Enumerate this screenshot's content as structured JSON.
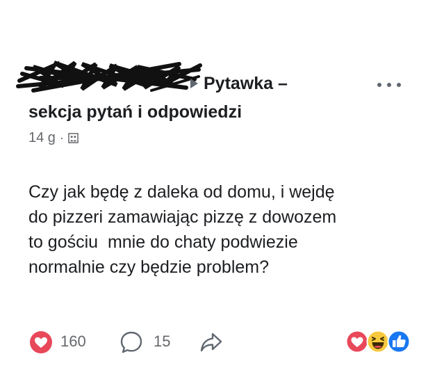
{
  "post": {
    "group_name_line1": "Pytawka –",
    "group_name_line2": "sekcja pytań i odpowiedzi",
    "timestamp": "14 g",
    "separator": "·",
    "body_lines": [
      "Czy jak będę z daleka od domu, i wejdę",
      "do pizzeri zamawiając pizzę z dowozem",
      "to gościu  mnie do chaty podwiezie",
      "normalnie czy będzie problem?"
    ]
  },
  "engagement": {
    "love_count": "160",
    "comment_count": "15"
  },
  "colors": {
    "love_red": "#e8485a",
    "like_blue": "#1877f2",
    "haha_yellow": "#f7c93e",
    "icon_gray": "#606770"
  },
  "icons": {
    "more": "more-options-icon",
    "arrow": "arrow-right-icon",
    "audience": "group-audience-icon",
    "love": "love-reaction-icon",
    "comment": "comment-icon",
    "share": "share-icon",
    "haha": "haha-reaction-icon",
    "like": "like-reaction-icon"
  }
}
